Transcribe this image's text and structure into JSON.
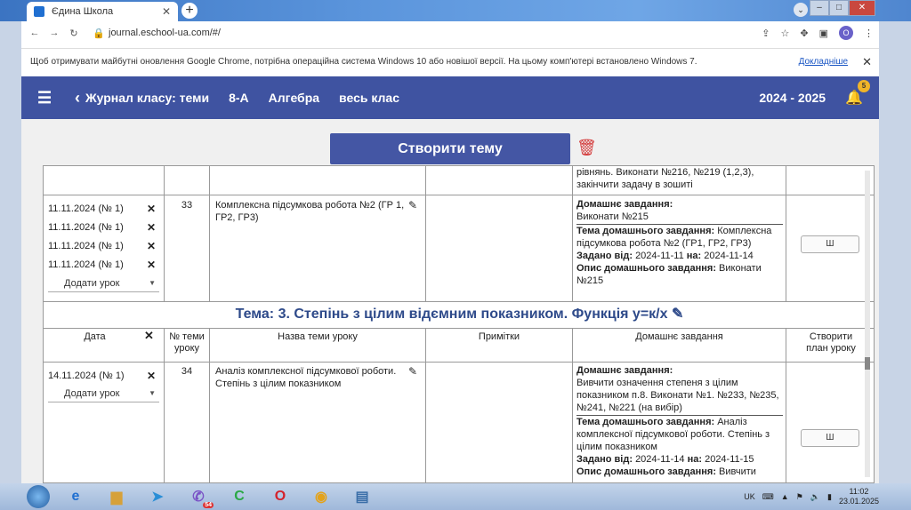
{
  "browser": {
    "tab_title": "Єдина Школа",
    "url": "journal.eschool-ua.com/#/",
    "profile_initial": "O",
    "infobar_text": "Щоб отримувати майбутні оновлення Google Chrome, потрібна операційна система Windows 10 або новішої версії. На цьому комп'ютері встановлено Windows 7.",
    "infobar_link": "Докладніше"
  },
  "appbar": {
    "title": "Журнал класу: теми",
    "class_name": "8-А",
    "subject": "Алгебра",
    "scope": "весь клас",
    "year": "2024 - 2025",
    "notifications": "5"
  },
  "toolbar": {
    "create_topic_label": "Створити тему"
  },
  "block1": {
    "top_fragment_line1": "рівнянь. Виконати №216, №219 (1,2,3),",
    "top_fragment_line2": "закінчити задачу в зошиті",
    "dates": [
      "11.11.2024 (№ 1)",
      "11.11.2024 (№ 1)",
      "11.11.2024 (№ 1)",
      "11.11.2024 (№ 1)"
    ],
    "add_lesson": "Додати урок",
    "number": "33",
    "lesson_title": "Комплексна підсумкова робота №2 (ГР 1, ГР2, ГР3)",
    "hw_label": "Домашнє завдання:",
    "hw_text": "Виконати №215",
    "hw_topic_label": "Тема домашнього завдання:",
    "hw_topic_text": "Комплексна підсумкова робота №2 (ГР1, ГР2, ГР3)",
    "given_label": "Задано від:",
    "given_from": "2024-11-11",
    "on_label": "на:",
    "given_to": "2024-11-14",
    "desc_label": "Опис домашнього завдання:",
    "desc_text": "Виконати №215",
    "plan_button": "Ш"
  },
  "topic": {
    "title": "Тема: 3. Степінь з цілим відємним показником. Функція у=к/х"
  },
  "headers": {
    "date": "Дата",
    "num_line1": "№ теми",
    "num_line2": "уроку",
    "lesson_name": "Назва теми уроку",
    "notes": "Примітки",
    "homework": "Домашнє завдання",
    "plan_line1": "Створити",
    "plan_line2": "план уроку"
  },
  "block2": {
    "date": "14.11.2024 (№ 1)",
    "add_lesson": "Додати урок",
    "number": "34",
    "lesson_title": "Аналіз комплексної підсумкової роботи. Степінь з цілим показником",
    "hw_label": "Домашнє завдання:",
    "hw_text": "Вивчити означення степеня з цілим показником п.8. Виконати №1. №233, №235, №241, №221 (на вибір)",
    "hw_topic_label": "Тема домашнього завдання:",
    "hw_topic_text": "Аналіз комплексної підсумкової роботи. Степінь з цілим показником",
    "given_label": "Задано від:",
    "given_from": "2024-11-14",
    "on_label": "на:",
    "given_to": "2024-11-15",
    "desc_label": "Опис домашнього завдання:",
    "desc_text": "Вивчити",
    "plan_button": "Ш"
  },
  "taskbar": {
    "lang": "UK",
    "viber_badge": "54",
    "time": "11:02",
    "date": "23.01.2025"
  }
}
